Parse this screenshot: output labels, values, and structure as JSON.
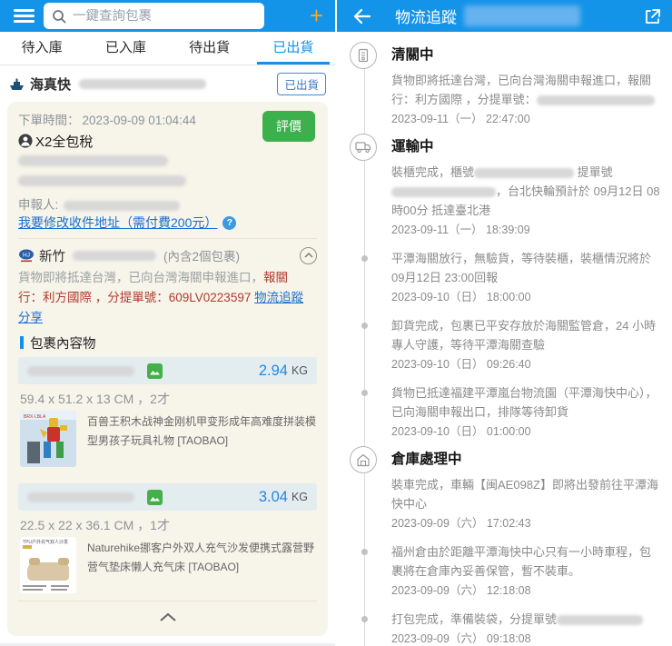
{
  "left": {
    "header": {
      "search_placeholder": "一鍵查詢包裹",
      "plus_label": "+"
    },
    "tabs": [
      {
        "label": "待入庫",
        "active": false
      },
      {
        "label": "已入庫",
        "active": false
      },
      {
        "label": "待出貨",
        "active": false
      },
      {
        "label": "已出貨",
        "active": true
      }
    ],
    "carrier": {
      "name": "海真快",
      "badge": "已出貨"
    },
    "order": {
      "time_label": "下單時間：",
      "time": "2023-09-09 01:04:44",
      "rate_button": "評價",
      "plan": "X2全包稅",
      "declarant_label": "申報人:",
      "address_link": "我要修改收件地址（需付費200元）",
      "station": "新竹",
      "parcel_count": "(內含2個包裹)",
      "status_gray": "貨物即將抵達台灣，已向台灣海關申報進口，",
      "status_red": "報關行：利方國際 ，分提單號：609LV0223597",
      "link_track": "物流追蹤",
      "link_share": "分享",
      "contents_header": "包裹內容物",
      "packages": [
        {
          "weight": "2.94",
          "unit": "KG",
          "dims": "59.4 x 51.2 x 13 CM ，2才",
          "title": "百兽王积木战神金刚机甲变形成年高难度拼装模型男孩子玩具礼物 [TAOBAO]"
        },
        {
          "weight": "3.04",
          "unit": "KG",
          "dims": "22.5 x 22 x 36.1 CM ，1才",
          "title": "Naturehike挪客户外双人充气沙发便携式露营野营气垫床懒人充气床 [TAOBAO]"
        }
      ]
    }
  },
  "right": {
    "title": "物流追蹤",
    "sections": [
      {
        "icon": "customs",
        "title": "清關中",
        "events": [
          {
            "dot": false,
            "segments": [
              {
                "t": "貨物即將抵達台灣，已向台灣海關申報進口，報關行：利方國際 ，分提單號："
              },
              {
                "b": 130
              }
            ],
            "time": "2023-09-11（一） 22:47:00"
          }
        ]
      },
      {
        "icon": "truck",
        "title": "運輸中",
        "events": [
          {
            "dot": false,
            "segments": [
              {
                "t": "裝櫃完成，櫃號"
              },
              {
                "b": 110
              },
              {
                "t": " 提單號 "
              },
              {
                "b": 115
              },
              {
                "t": "，台北快輪預計於 09月12日 08時00分 抵達臺北港"
              }
            ],
            "time": "2023-09-11（一） 18:39:09"
          },
          {
            "dot": true,
            "segments": [
              {
                "t": "平潭海關放行，無驗貨，等待裝櫃，裝櫃情況將於09月12日 23:00回報"
              }
            ],
            "time": "2023-09-10（日） 18:00:00"
          },
          {
            "dot": true,
            "segments": [
              {
                "t": "卸貨完成，包裹已平安存放於海關監管倉，24 小時專人守護，等待平潭海關查驗"
              }
            ],
            "time": "2023-09-10（日） 09:26:40"
          },
          {
            "dot": true,
            "segments": [
              {
                "t": "貨物已抵達福建平潭嵐台物流園（平潭海快中心），已向海關申報出口，排隊等待卸貨"
              }
            ],
            "time": "2023-09-10（日） 01:00:00"
          }
        ]
      },
      {
        "icon": "warehouse",
        "title": "倉庫處理中",
        "events": [
          {
            "dot": false,
            "segments": [
              {
                "t": "裝車完成，車輛【闽AE098Z】即將出發前往平潭海快中心"
              }
            ],
            "time": "2023-09-09（六） 17:02:43"
          },
          {
            "dot": true,
            "segments": [
              {
                "t": "福州倉由於距離平潭海快中心只有一小時車程，包裹將在倉庫內妥善保管，暫不裝車。"
              }
            ],
            "time": "2023-09-09（六） 12:18:08"
          },
          {
            "dot": true,
            "segments": [
              {
                "t": "打包完成，準備裝袋，分提單號"
              },
              {
                "b": 95
              }
            ],
            "time": "2023-09-09（六） 09:18:08"
          }
        ]
      }
    ]
  },
  "colors": {
    "header_blue": "#1494e8",
    "accent_blue": "#1590e9",
    "weight_blue": "#1e88e5",
    "link_blue": "#186fd3",
    "green": "#3cb04c",
    "orange_plus": "#f5a51d",
    "red_text": "#b03a2e",
    "card_bg": "#f7f4ea",
    "pkg_bar_bg": "#e3edf0",
    "badge_blue": "#4a86c8"
  }
}
